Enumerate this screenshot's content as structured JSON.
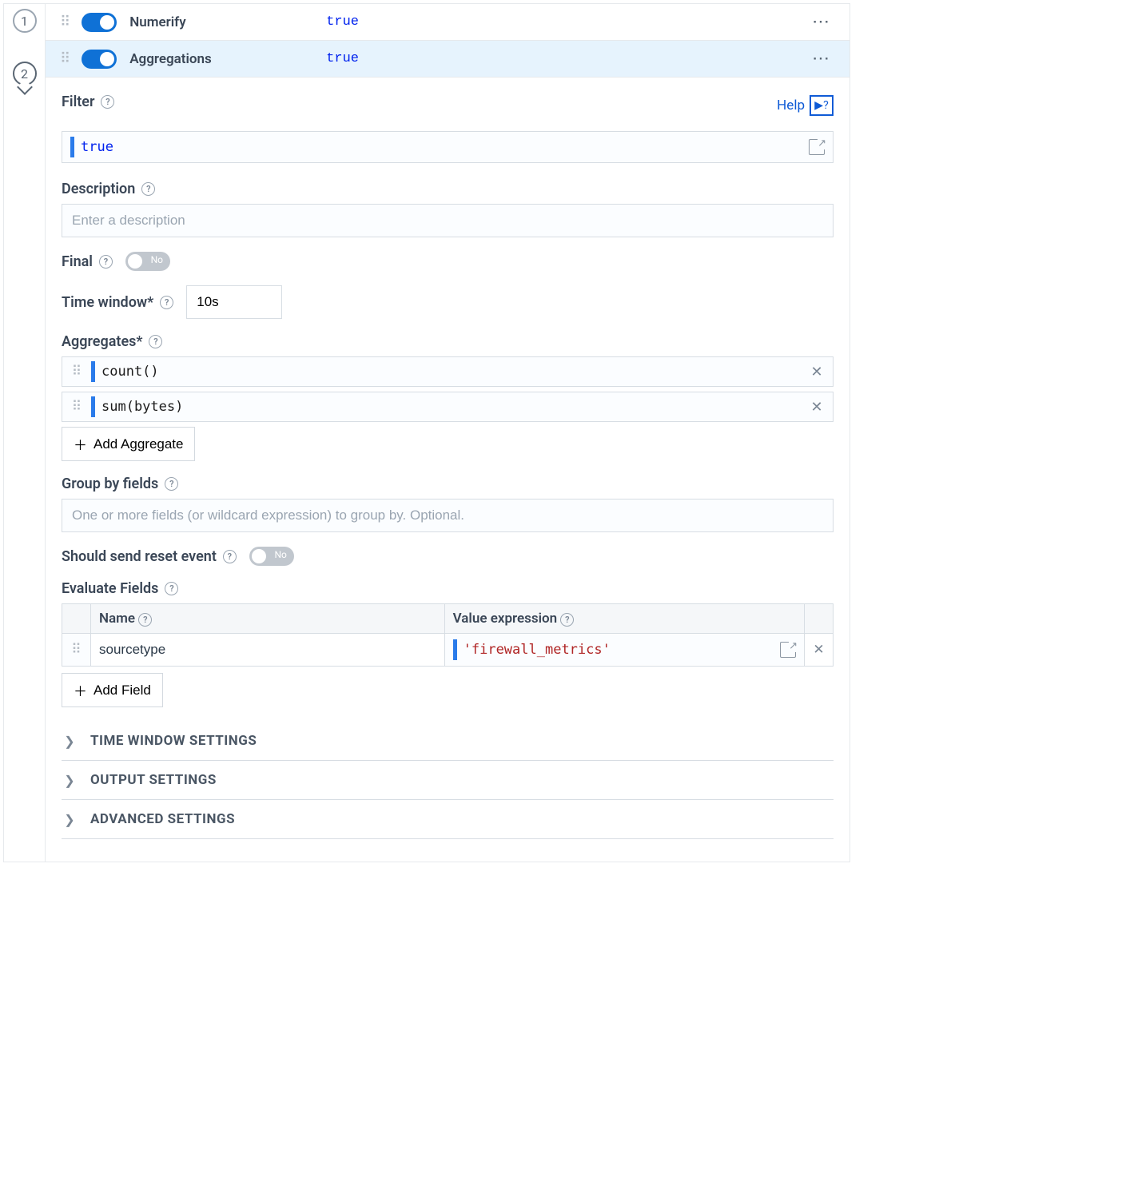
{
  "stages": [
    {
      "name": "Numerify",
      "expr": "true",
      "enabled": true
    },
    {
      "name": "Aggregations",
      "expr": "true",
      "enabled": true
    }
  ],
  "helpLabel": "Help",
  "filter": {
    "label": "Filter",
    "value": "true"
  },
  "description": {
    "label": "Description",
    "placeholder": "Enter a description",
    "value": ""
  },
  "final": {
    "label": "Final",
    "state": "No"
  },
  "timeWindow": {
    "label": "Time window*",
    "value": "10s"
  },
  "aggregates": {
    "label": "Aggregates*",
    "items": [
      "count()",
      "sum(bytes)"
    ],
    "addBtn": "Add Aggregate"
  },
  "groupBy": {
    "label": "Group by fields",
    "placeholder": "One or more fields (or wildcard expression) to group by. Optional."
  },
  "resetEvent": {
    "label": "Should send reset event",
    "state": "No"
  },
  "evalFields": {
    "label": "Evaluate Fields",
    "headers": {
      "name": "Name",
      "value": "Value expression"
    },
    "rows": [
      {
        "name": "sourcetype",
        "value": "'firewall_metrics'"
      }
    ],
    "addBtn": "Add Field"
  },
  "sections": [
    "TIME WINDOW SETTINGS",
    "OUTPUT SETTINGS",
    "ADVANCED SETTINGS"
  ]
}
